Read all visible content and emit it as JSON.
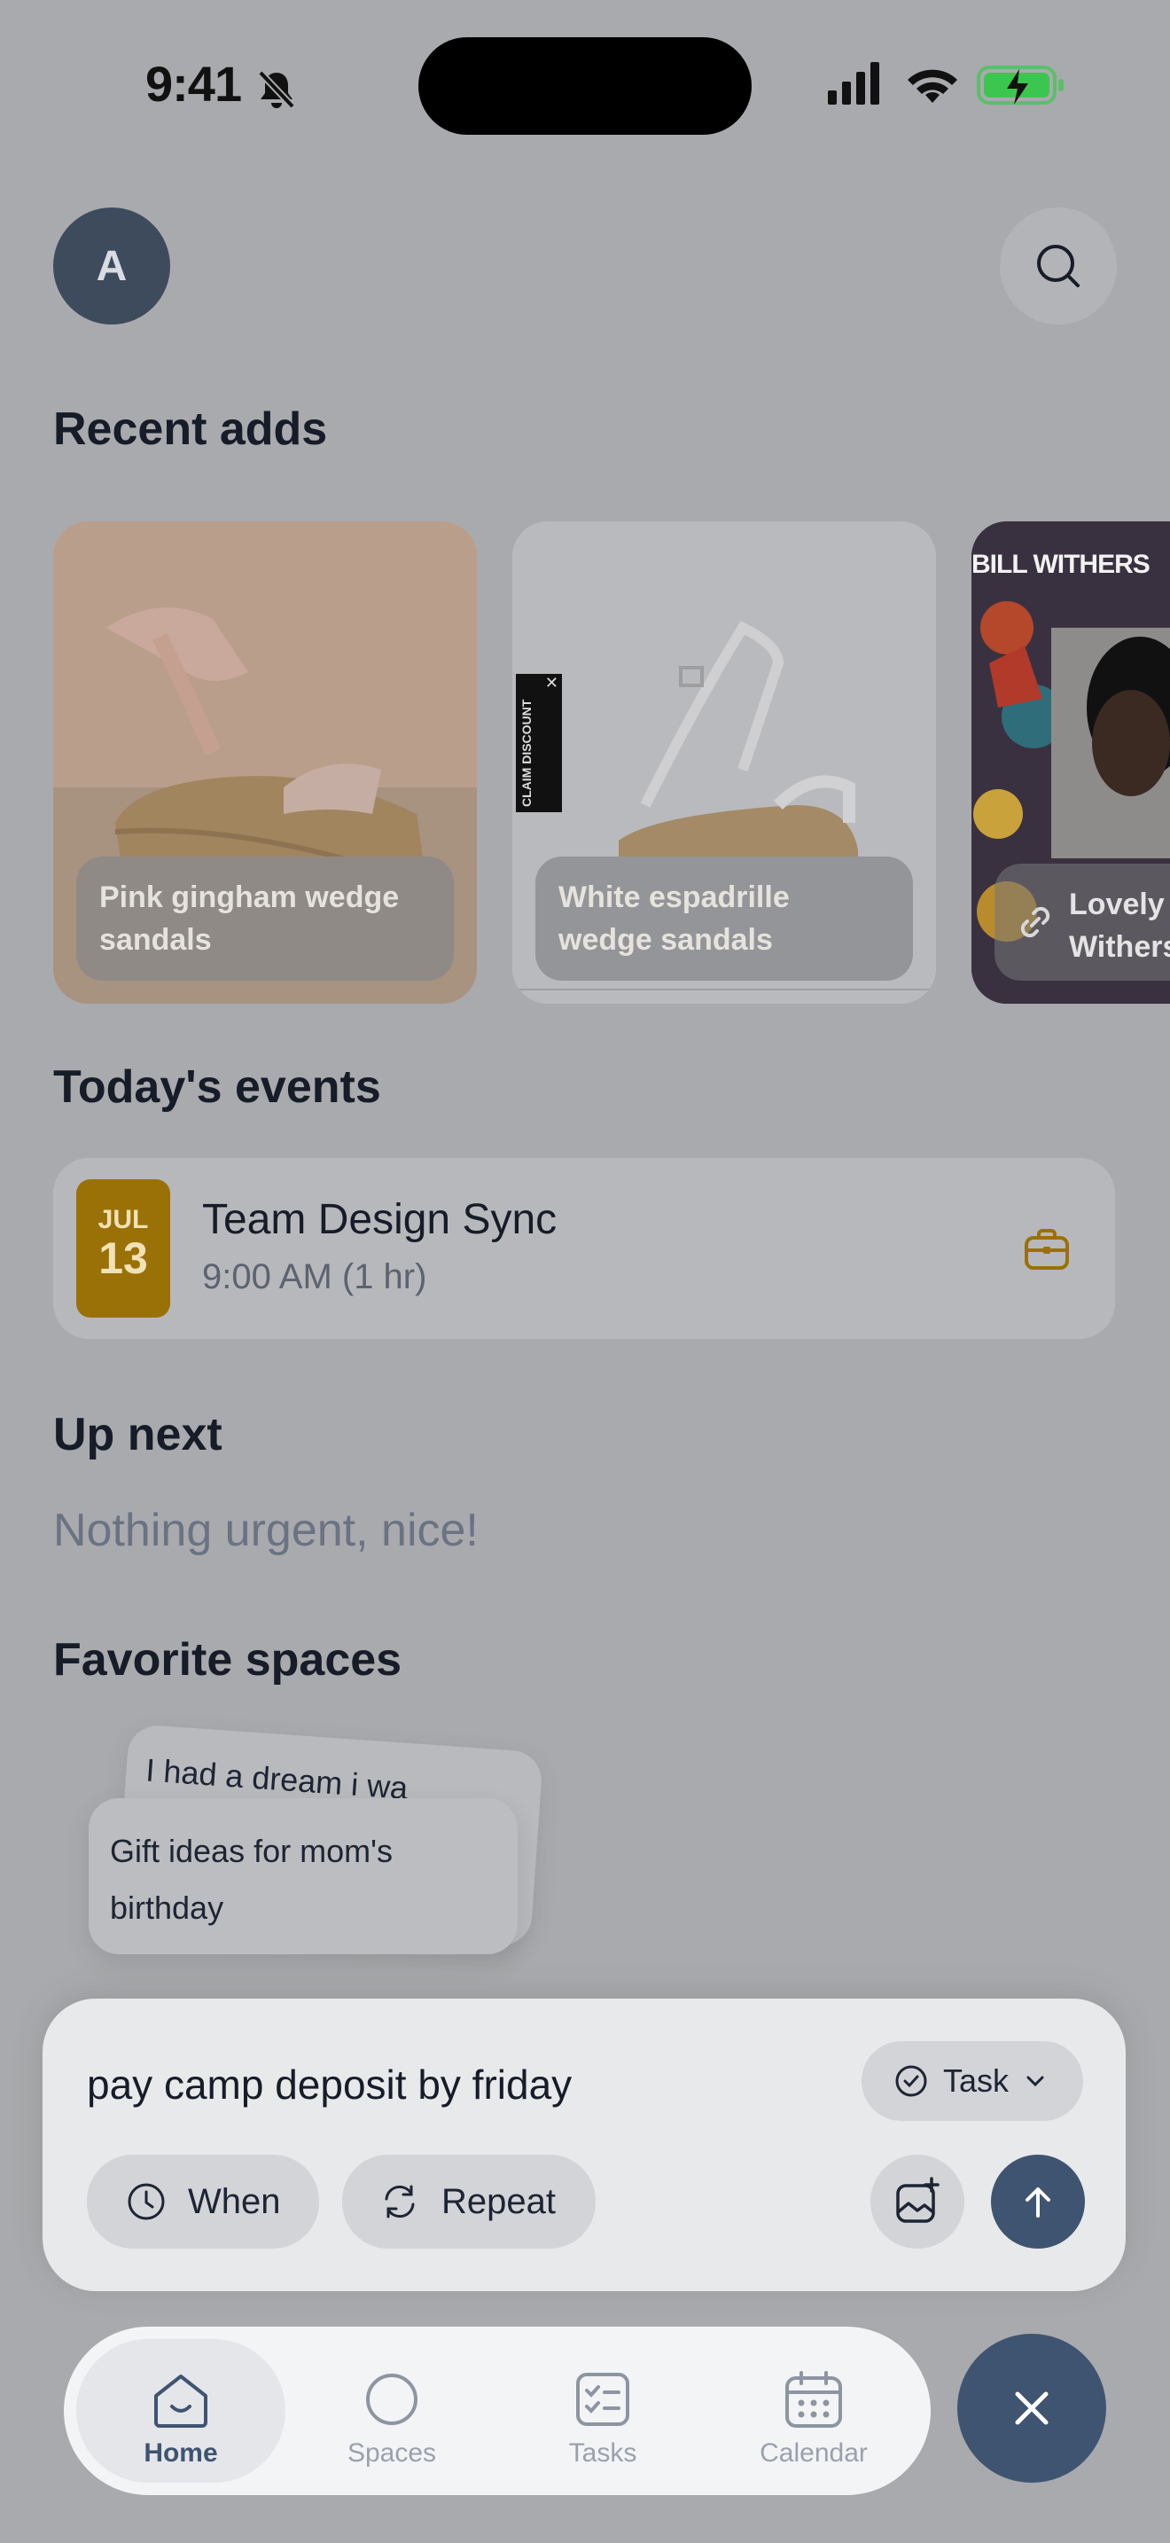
{
  "status_bar": {
    "time": "9:41"
  },
  "header": {
    "avatar_initial": "A"
  },
  "recent_adds": {
    "title": "Recent adds",
    "items": [
      {
        "caption": "Pink gingham wedge sandals"
      },
      {
        "caption": "White espadrille wedge sandals",
        "ad_tag": "CLAIM DISCOUNT"
      },
      {
        "caption": "Lovely Withers",
        "banner": "BILL WITHERS"
      }
    ]
  },
  "events": {
    "title": "Today's events",
    "items": [
      {
        "month": "JUL",
        "day": "13",
        "name": "Team Design Sync",
        "time": "9:00 AM (1 hr)"
      }
    ]
  },
  "up_next": {
    "title": "Up next",
    "message": "Nothing urgent, nice!"
  },
  "favorite_spaces": {
    "title": "Favorite spaces",
    "items": [
      {
        "label": "I had a dream i wa"
      },
      {
        "label": "Gift ideas for mom's birthday"
      }
    ]
  },
  "composer": {
    "input_value": "pay camp deposit by friday",
    "type_label": "Task",
    "when_label": "When",
    "repeat_label": "Repeat"
  },
  "tabbar": {
    "tabs": [
      {
        "label": "Home",
        "active": true
      },
      {
        "label": "Spaces"
      },
      {
        "label": "Tasks"
      },
      {
        "label": "Calendar"
      }
    ]
  },
  "colors": {
    "accent": "#3f5470",
    "event_badge": "#9a7106",
    "battery": "#3bc74f"
  }
}
